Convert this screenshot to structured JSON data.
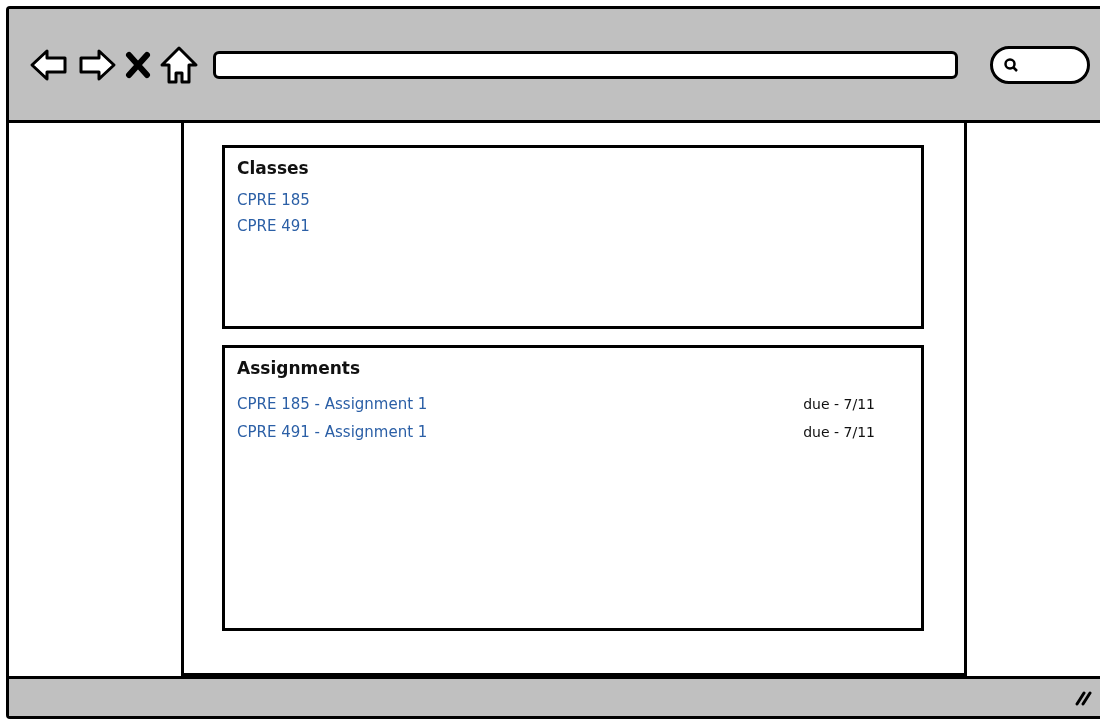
{
  "classes": {
    "title": "Classes",
    "items": [
      {
        "label": "CPRE 185"
      },
      {
        "label": "CPRE 491"
      }
    ]
  },
  "assignments": {
    "title": "Assignments",
    "items": [
      {
        "label": "CPRE 185 - Assignment 1",
        "due": "due - 7/11"
      },
      {
        "label": "CPRE 491 - Assignment 1",
        "due": "due - 7/11"
      }
    ]
  }
}
